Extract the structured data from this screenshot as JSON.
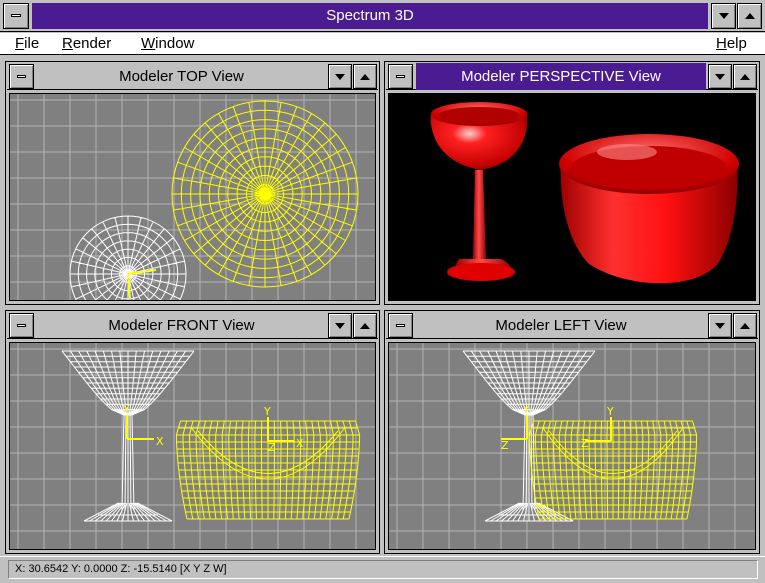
{
  "app": {
    "title": "Spectrum 3D"
  },
  "menu": {
    "file": {
      "key": "F",
      "rest": "ile"
    },
    "render": {
      "key": "R",
      "rest": "ender"
    },
    "window": {
      "key": "W",
      "rest": "indow"
    },
    "help": {
      "key": "H",
      "rest": "elp"
    }
  },
  "views": {
    "top": {
      "title": "Modeler TOP View"
    },
    "perspective": {
      "title": "Modeler PERSPECTIVE View"
    },
    "front": {
      "title": "Modeler FRONT View"
    },
    "left": {
      "title": "Modeler LEFT View"
    }
  },
  "axes": {
    "x": "X",
    "y": "Y",
    "z": "Z"
  },
  "status": {
    "text": "X: 30.6542 Y: 0.0000 Z: -15.5140  [X Y Z W]"
  },
  "colors": {
    "title_active": "#4b1b92",
    "viewport_bg": "#808080",
    "grid": "#b4b4b4",
    "wire_selected": "#ffff00",
    "wire_unselected": "#ffffff",
    "render_object": "#ff0000",
    "perspective_bg": "#000000"
  },
  "icons": {
    "system_menu": "system-menu-icon",
    "minimize": "minimize-arrow-icon",
    "maximize": "maximize-arrow-icon"
  }
}
